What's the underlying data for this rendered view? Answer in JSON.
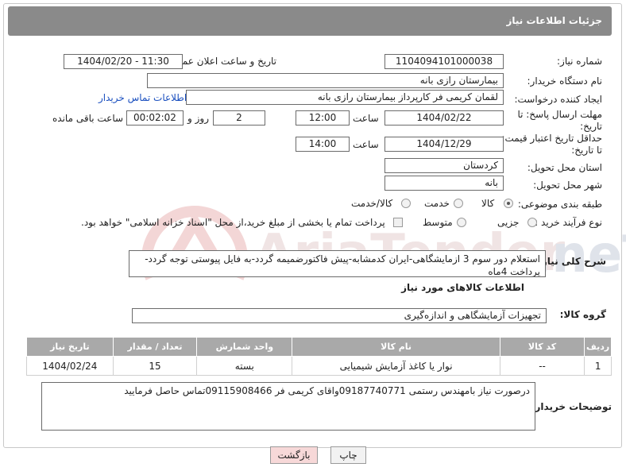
{
  "header": {
    "title": "جزئیات اطلاعات نیاز"
  },
  "fields": {
    "need_number_label": "شماره نیاز:",
    "need_number": "1104094101000038",
    "announce_label": "تاریخ و ساعت اعلان عمومی:",
    "announce_value": "1404/02/20 - 11:30",
    "buyer_org_label": "نام دستگاه خریدار:",
    "buyer_org": "بیمارستان رازی بانه",
    "requester_label": "ایجاد کننده درخواست:",
    "requester": "لقمان کریمی فر کارپرداز بیمارستان رازی بانه",
    "contact_link": "اطلاعات تماس خریدار",
    "deadline_label": "مهلت ارسال پاسخ: تا تاریخ:",
    "deadline_date": "1404/02/22",
    "time_label": "ساعت",
    "deadline_time": "12:00",
    "remaining_days": "2",
    "day_and_label": "روز و",
    "remaining_time": "00:02:02",
    "remaining_label": "ساعت باقی مانده",
    "validity_label": "حداقل تاریخ اعتبار قیمت: تا تاریخ:",
    "validity_date": "1404/12/29",
    "validity_time": "14:00",
    "province_label": "استان محل تحویل:",
    "province": "کردستان",
    "city_label": "شهر محل تحویل:",
    "city": "بانه",
    "category_label": "طبقه بندی موضوعی:",
    "category_options": [
      "کالا",
      "خدمت",
      "کالا/خدمت"
    ],
    "process_label": "نوع فرآیند خرید :",
    "process_options": [
      "جزیی",
      "متوسط"
    ],
    "payment_note": "پرداخت تمام یا بخشی از مبلغ خرید،از محل \"اسناد خزانه اسلامی\" خواهد بود.",
    "description_label": "شرح کلی نیاز:",
    "description": "استعلام دور سوم 3 ازمایشگاهی-ایران کدمشابه-پیش فاکتورضمیمه گردد-به فایل پیوستی توجه گردد-پرداخت 4ماه",
    "goods_info_title": "اطلاعات کالاهای مورد نیاز",
    "goods_group_label": "گروه کالا:",
    "goods_group": "تجهیزات آزمایشگاهی و اندازه‌گیری",
    "buyer_notes_label": "توضیحات خریدار:",
    "buyer_notes": "درصورت نیاز بامهندس رستمی 09187740771واقای کریمی فر 09115908466تماس حاصل فرمایید"
  },
  "table": {
    "headers": [
      "ردیف",
      "کد کالا",
      "نام کالا",
      "واحد شمارش",
      "تعداد / مقدار",
      "تاریخ نیاز"
    ],
    "rows": [
      [
        "1",
        "--",
        "نوار یا کاغذ آزمایش شیمیایی",
        "بسته",
        "15",
        "1404/02/24"
      ]
    ]
  },
  "buttons": {
    "print": "چاپ",
    "back": "بازگشت"
  },
  "colors": {
    "header_bg": "#8a8a8a",
    "link": "#1a4fbf",
    "back_btn_bg": "#f7d8d8"
  }
}
